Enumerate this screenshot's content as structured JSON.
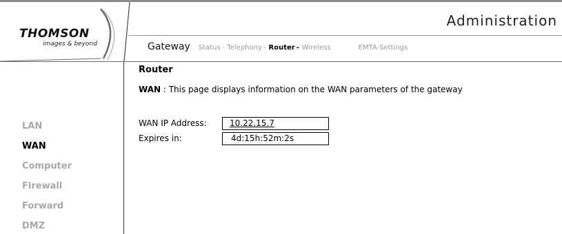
{
  "header": {
    "logo": {
      "brand": "THOMSON",
      "tagline": "images & beyond"
    },
    "title": "Administration"
  },
  "main_nav": {
    "gateway_label": "Gateway",
    "items": [
      {
        "label": "Status",
        "separator": "-"
      },
      {
        "label": "Telephony",
        "separator": "-"
      },
      {
        "label": "Router",
        "separator": "-",
        "active": true
      },
      {
        "label": "Wireless",
        "separator": ""
      },
      {
        "label": "EMTA-Settings",
        "separator": ""
      }
    ]
  },
  "sidebar": {
    "items": [
      {
        "label": "LAN"
      },
      {
        "label": "WAN",
        "active": true
      },
      {
        "label": "Computer"
      },
      {
        "label": "Firewall"
      },
      {
        "label": "Forward"
      },
      {
        "label": "DMZ"
      }
    ]
  },
  "content": {
    "heading": "Router",
    "description_key": "WAN",
    "description_text": " : This page displays information on the WAN parameters of the gateway",
    "fields": [
      {
        "label": "WAN IP Address:",
        "value": "10.22.15.7"
      },
      {
        "label": "Expires in:",
        "value": "4d:15h:52m:2s"
      }
    ]
  }
}
